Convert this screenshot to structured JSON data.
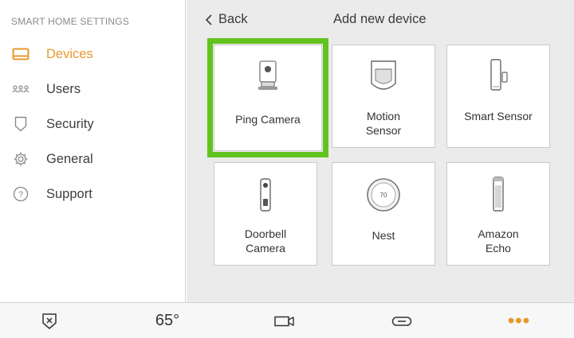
{
  "sidebar": {
    "title": "SMART HOME SETTINGS",
    "items": [
      {
        "label": "Devices",
        "icon": "devices-icon",
        "active": true
      },
      {
        "label": "Users",
        "icon": "users-icon",
        "active": false
      },
      {
        "label": "Security",
        "icon": "shield-icon",
        "active": false
      },
      {
        "label": "General",
        "icon": "gear-icon",
        "active": false
      },
      {
        "label": "Support",
        "icon": "help-icon",
        "active": false
      }
    ]
  },
  "header": {
    "back_label": "Back",
    "title": "Add new device"
  },
  "devices": [
    {
      "label": "Ping Camera",
      "icon": "camera-icon",
      "selected": true
    },
    {
      "label": "Motion\nSensor",
      "icon": "motion-sensor-icon",
      "selected": false
    },
    {
      "label": "Smart Sensor",
      "icon": "smart-sensor-icon",
      "selected": false
    },
    {
      "label": "Doorbell\nCamera",
      "icon": "doorbell-icon",
      "selected": false
    },
    {
      "label": "Nest",
      "icon": "thermostat-icon",
      "selected": false,
      "display_value": "70"
    },
    {
      "label": "Amazon\nEcho",
      "icon": "echo-icon",
      "selected": false
    }
  ],
  "bottom_bar": {
    "temperature": "65°",
    "more": "•••"
  },
  "colors": {
    "accent": "#e8982b",
    "selection": "#62c21f",
    "main_bg": "#ebebeb"
  }
}
